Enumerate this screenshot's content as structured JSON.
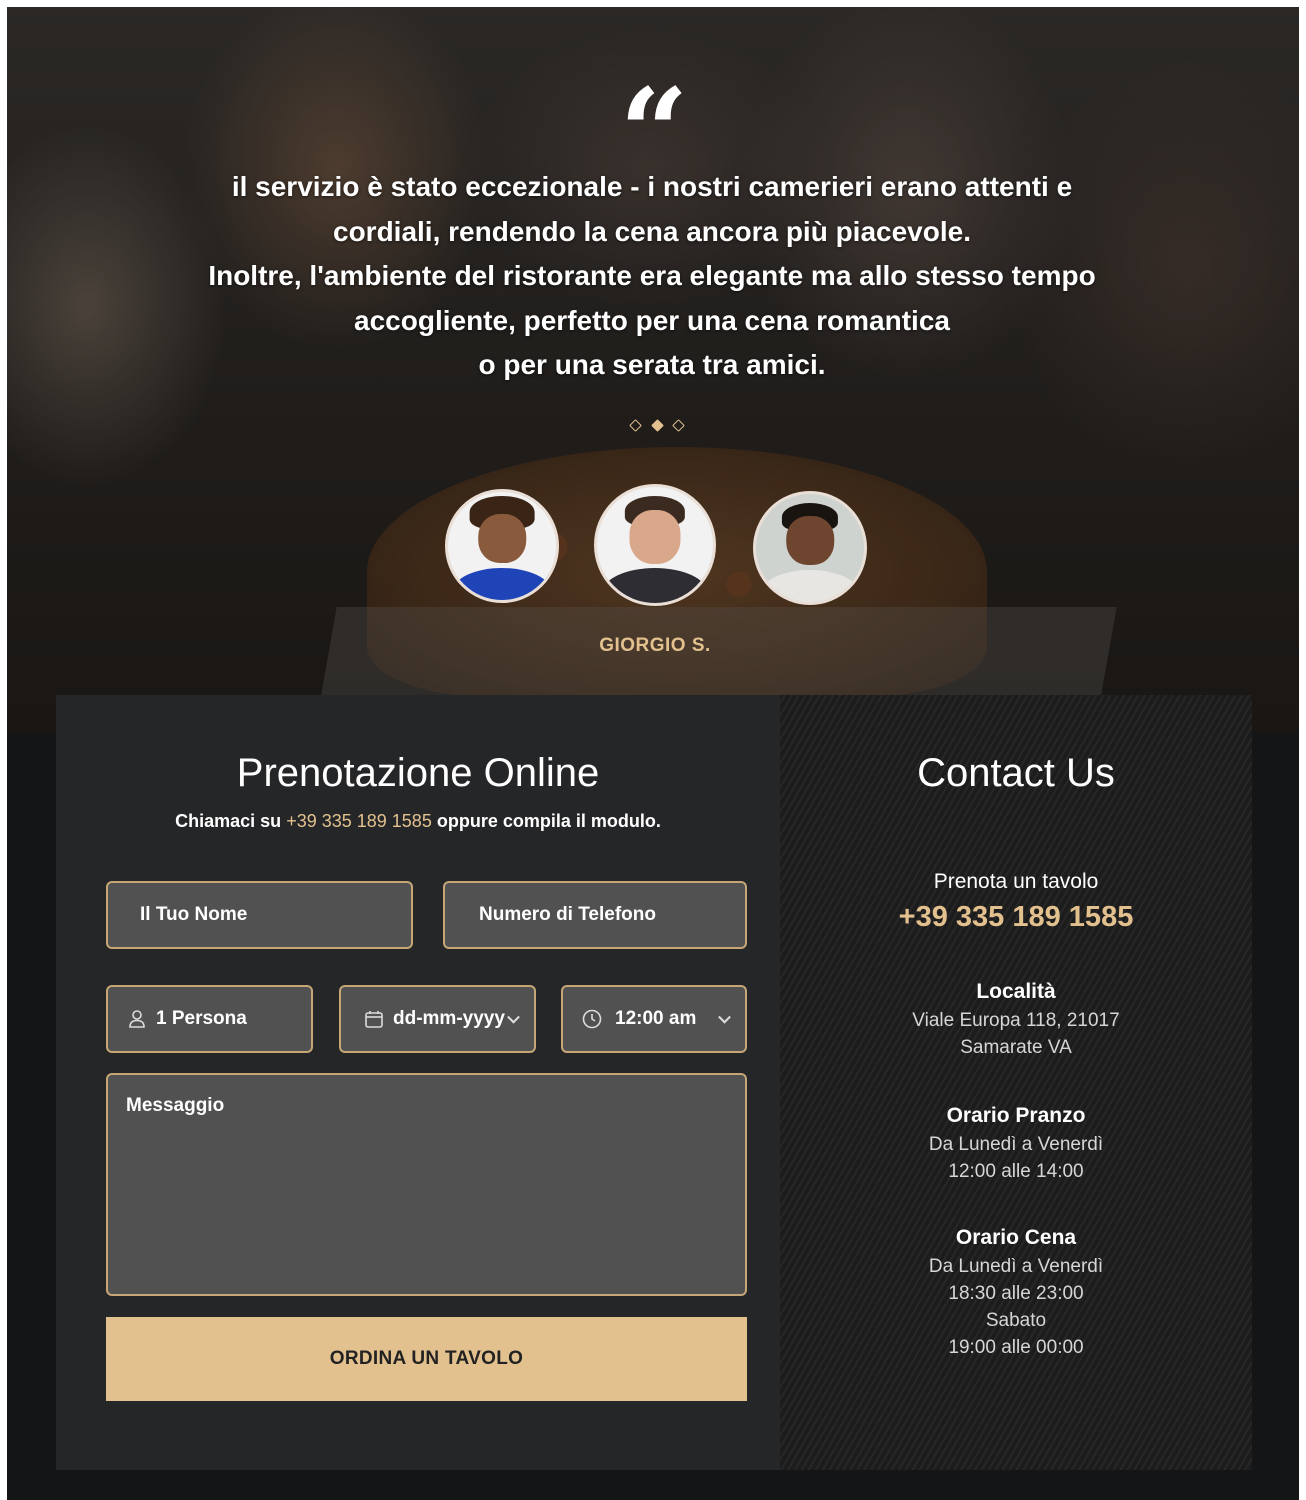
{
  "testimonial": {
    "quote_glyph": "“",
    "text": "il servizio è stato eccezionale - i nostri camerieri erano attenti e\ncordiali, rendendo la cena ancora più piacevole.\nInoltre, l'ambiente del ristorante era elegante ma allo stesso tempo\naccogliente, perfetto per una cena romantica\no per una serata tra amici.",
    "reviewer_name": "GIORGIO S.",
    "active_slide": 2,
    "slide_count": 3
  },
  "booking": {
    "title": "Prenotazione Online",
    "subtitle_prefix": "Chiamaci su",
    "subtitle_phone": "+39 335 189 1585",
    "subtitle_suffix": "oppure compila il modulo.",
    "name_placeholder": "Il Tuo Nome",
    "phone_placeholder": "Numero di Telefono",
    "persons_value": "1 Persona",
    "date_value": "dd-mm-yyyy",
    "time_value": "12:00 am",
    "message_placeholder": "Messaggio",
    "submit_label": "ORDINA UN TAVOLO"
  },
  "contact": {
    "title": "Contact Us",
    "reserve_label": "Prenota un tavolo",
    "reserve_phone": "+39 335 189 1585",
    "location_label": "Località",
    "location_line1": "Viale Europa 118, 21017",
    "location_line2": "Samarate VA",
    "lunch_label": "Orario Pranzo",
    "lunch_days": "Da Lunedì a Venerdì",
    "lunch_hours": "12:00 alle 14:00",
    "dinner_label": "Orario Cena",
    "dinner_days": "Da Lunedì a Venerdì",
    "dinner_hours": "18:30 alle 23:00",
    "saturday_label": "Sabato",
    "saturday_hours": "19:00 alle 00:00"
  },
  "colors": {
    "accent": "#e3c18f",
    "panel": "#252628",
    "field": "#515151",
    "page_bg": "#141516"
  },
  "icons": [
    "quote-icon",
    "user-icon",
    "calendar-icon",
    "clock-icon",
    "chevron-down-icon"
  ]
}
